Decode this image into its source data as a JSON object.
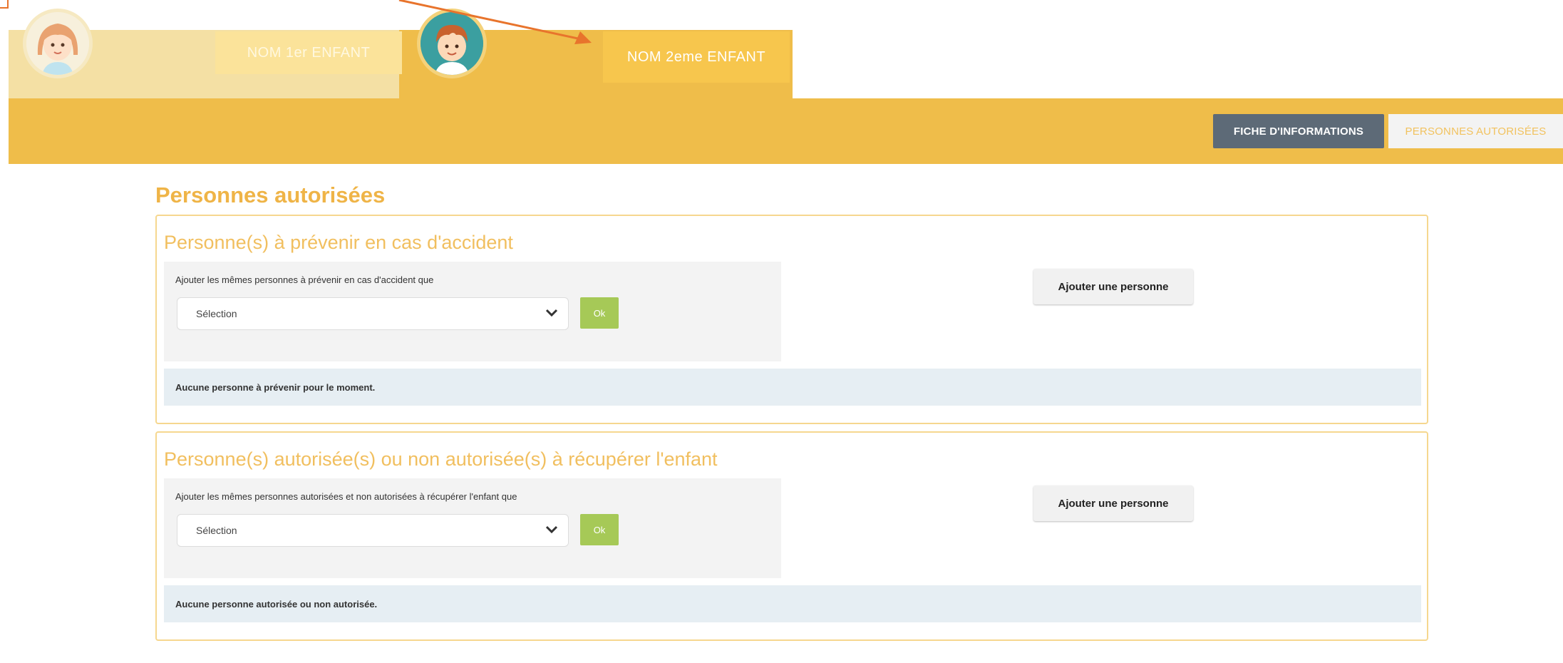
{
  "tabs": {
    "child1_name": "NOM  1er ENFANT",
    "child2_name": "NOM 2eme ENFANT"
  },
  "nav": {
    "fiche_label": "FICHE D'INFORMATIONS",
    "personnes_label": "PERSONNES AUTORISÉES"
  },
  "page": {
    "title": "Personnes autorisées"
  },
  "sections": [
    {
      "title": "Personne(s) à prévenir en cas d'accident",
      "copy_label": "Ajouter les mêmes personnes à prévenir en cas d'accident que",
      "select_value": "Sélection",
      "ok_label": "Ok",
      "add_label": "Ajouter une personne",
      "empty_message": "Aucune personne à prévenir pour le moment."
    },
    {
      "title": "Personne(s) autorisée(s) ou non autorisée(s) à récupérer l'enfant",
      "copy_label": "Ajouter les mêmes personnes autorisées et non autorisées à récupérer l'enfant que",
      "select_value": "Sélection",
      "ok_label": "Ok",
      "add_label": "Ajouter une personne",
      "empty_message": "Aucune personne autorisée ou non autorisée."
    }
  ],
  "colors": {
    "brand_yellow": "#efbd4a",
    "title_orange": "#efb447",
    "ok_green": "#a6c957",
    "nav_dark": "#5d6a77",
    "arrow": "#e8742c"
  },
  "icons": {
    "child1_avatar": "girl-avatar-icon",
    "child2_avatar": "boy-avatar-icon",
    "select_chevron": "chevron-down-icon",
    "annotation_arrow": "arrow-annotation-icon"
  }
}
